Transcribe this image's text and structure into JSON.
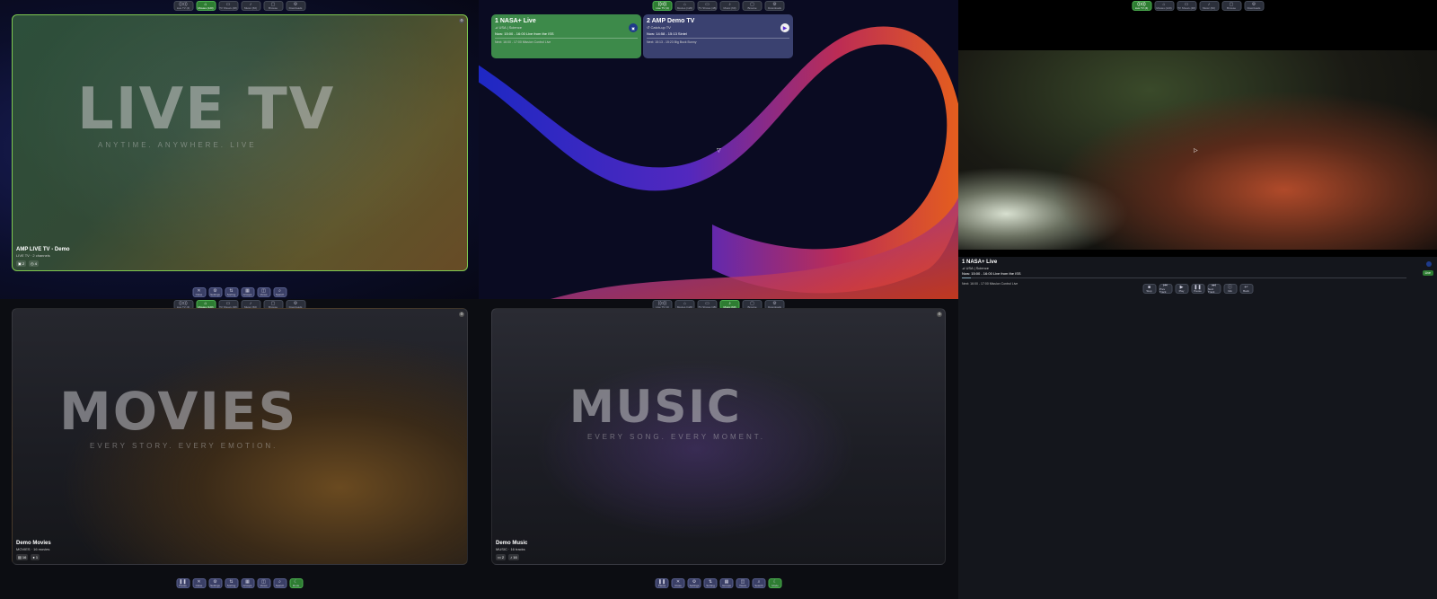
{
  "topnav": [
    {
      "icon": "wifi-icon",
      "glyph": "((o))",
      "label": "Live TV (4)"
    },
    {
      "icon": "house-icon",
      "glyph": "⌂",
      "label": "Movies (120)"
    },
    {
      "icon": "tv-icon",
      "glyph": "▭",
      "label": "TV Shows (48)"
    },
    {
      "icon": "music-icon",
      "glyph": "♪",
      "label": "Music (60)"
    },
    {
      "icon": "folder-icon",
      "glyph": "▢",
      "label": "Browse"
    },
    {
      "icon": "gear-icon",
      "glyph": "⚙",
      "label": "Downloads"
    }
  ],
  "live_tv_hero": {
    "bg_title": "LIVE TV",
    "bg_sub": "ANYTIME. ANYWHERE. LIVE",
    "title": "AMP LIVE TV - Demo",
    "subtitle": "LIVE TV · 2 channels",
    "badge1": "2",
    "badge2": "4"
  },
  "channels": [
    {
      "name": "1 NASA+ Live",
      "category": "USA | Science",
      "now": "Now: 15:00 - 16:00 Live from the ISS",
      "next": "Next: 16:00 - 17:00 Mission Control Live"
    },
    {
      "name": "2 AMP Demo TV",
      "category": "Catch-up TV",
      "now": "Now: 14:58 - 15:13 Sintel",
      "next": "Next: 15:13 - 15:23 Big Buck Bunny"
    }
  ],
  "player": {
    "name": "1 NASA+ Live",
    "category": "USA | Science",
    "now": "Now: 15:00 - 16:00 Live from the ISS",
    "next": "Next: 16:00 - 17:00 Mission Control Live",
    "live": "Live",
    "progress": 0.02,
    "controls": [
      "Stop",
      "Prev Track",
      "Play",
      "Pause",
      "Next Track",
      "Info",
      "Back"
    ]
  },
  "livetv_bottom": [
    "Close",
    "Settings",
    "Sorting",
    "Groups",
    "Views",
    "Search"
  ],
  "movies_hero": {
    "bg_title": "MOVIES",
    "bg_sub": "EVERY STORY. EVERY EMOTION.",
    "title": "Demo Movies",
    "subtitle": "MOVIES · 16 movies",
    "badge1": "16",
    "badge2": "1"
  },
  "music_hero": {
    "bg_title": "MUSIC",
    "bg_sub": "EVERY SONG. EVERY MOMENT.",
    "title": "Demo Music",
    "subtitle": "MUSIC · 16 tracks",
    "badge1": "2",
    "badge2": "16"
  },
  "media_bottom": [
    "Pause",
    "Close",
    "Settings",
    "Sorting",
    "Groups",
    "Views",
    "Search",
    "Mode"
  ]
}
